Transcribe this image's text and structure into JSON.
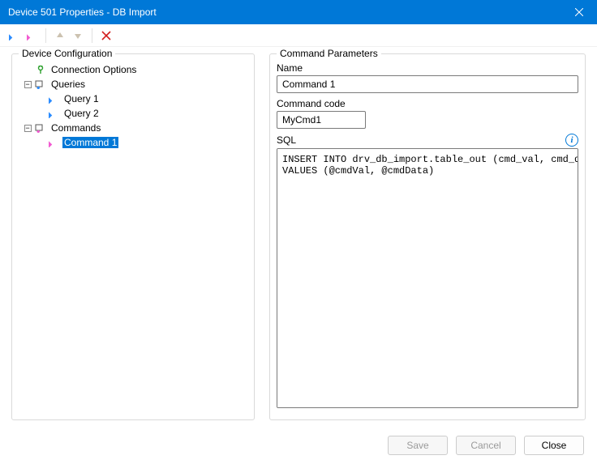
{
  "title": "Device 501 Properties - DB Import",
  "toolbar": {
    "add_query_tip": "Add Query",
    "add_command_tip": "Add Command",
    "move_up_tip": "Move Up",
    "move_down_tip": "Move Down",
    "delete_tip": "Delete"
  },
  "left_panel": {
    "legend": "Device Configuration",
    "tree": {
      "connection": {
        "label": "Connection Options"
      },
      "queries": {
        "label": "Queries",
        "children": [
          {
            "label": "Query 1"
          },
          {
            "label": "Query 2"
          }
        ]
      },
      "commands": {
        "label": "Commands",
        "children": [
          {
            "label": "Command 1",
            "selected": true
          }
        ]
      }
    }
  },
  "right_panel": {
    "legend": "Command Parameters",
    "name_label": "Name",
    "name_value": "Command 1",
    "code_label": "Command code",
    "code_value": "MyCmd1",
    "sql_label": "SQL",
    "sql_value": "INSERT INTO drv_db_import.table_out (cmd_val, cmd_data)\nVALUES (@cmdVal, @cmdData)"
  },
  "footer": {
    "save": "Save",
    "cancel": "Cancel",
    "close": "Close"
  }
}
